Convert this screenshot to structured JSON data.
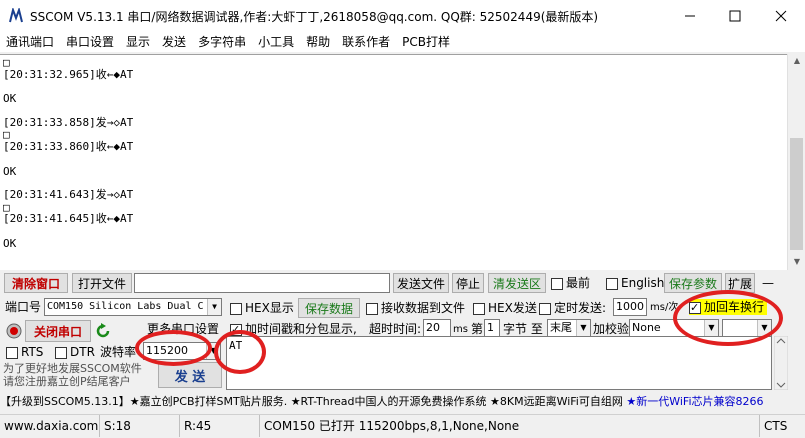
{
  "window": {
    "title": "SSCOM V5.13.1 串口/网络数据调试器,作者:大虾丁丁,2618058@qq.com. QQ群: 52502449(最新版本)"
  },
  "menu": {
    "items": [
      "通讯端口",
      "串口设置",
      "显示",
      "发送",
      "多字符串",
      "小工具",
      "帮助",
      "联系作者",
      "PCB打样"
    ]
  },
  "receive": {
    "lines": [
      "□",
      "[20:31:32.965]收←◆AT",
      "",
      "OK",
      "",
      "[20:31:33.858]发→◇AT",
      "□",
      "[20:31:33.860]收←◆AT",
      "",
      "OK",
      "",
      "[20:31:41.643]发→◇AT",
      "□",
      "[20:31:41.645]收←◆AT",
      "",
      "OK"
    ]
  },
  "toolbar": {
    "clear_window": "清除窗口",
    "open_file": "打开文件",
    "send_file": "发送文件",
    "stop": "停止",
    "clear_send": "清发送区",
    "front_label": "最前",
    "english_label": "English",
    "save_params": "保存参数",
    "expand": "扩展",
    "collapse": "—"
  },
  "panel": {
    "port_label": "端口号",
    "port_value": "COM150 Silicon Labs Dual C",
    "hex_display": "HEX显示",
    "save_data": "保存数据",
    "recv_to_file": "接收数据到文件",
    "hex_send": "HEX发送",
    "timed_send": "定时发送:",
    "timed_value": "1000",
    "timed_unit": "ms/次",
    "add_crlf": "加回车换行",
    "close_port": "关闭串口",
    "more_settings": "更多串口设置",
    "timestamp": "加时间戳和分包显示,",
    "timeout_label": "超时时间:",
    "timeout_value": "20",
    "timeout_unit": "ms",
    "nth_label": "第",
    "nth_value": "1",
    "byte_label": "字节 至",
    "end_value": "末尾",
    "checksum_label": "加校验",
    "checksum_value": "None",
    "rts": "RTS",
    "dtr": "DTR",
    "baud_label": "波特率",
    "baud_value": "115200",
    "promo_line1": "为了更好地发展SSCOM软件",
    "promo_line2": "请您注册嘉立创P结尾客户",
    "send_button": "发 送",
    "send_text": "AT"
  },
  "ticker": {
    "text_a": "【升级到SSCOM5.13.1】★嘉立创PCB打样SMT贴片服务. ★RT-Thread中国人的开源免费操作系统 ★8KM远距离WiFi可自组网 ",
    "text_b": "★新一代WiFi芯片兼容8266"
  },
  "status": {
    "website": "www.daxia.com",
    "sent": "S:18",
    "received": "R:45",
    "port_state": "COM150 已打开  115200bps,8,1,None,None",
    "cts": "CTS"
  },
  "colors": {
    "highlight_red": "#e02020",
    "save_green": "#1a7a1a",
    "crlf_yellow": "#ffff00",
    "ticker_blue": "#0000cc"
  }
}
